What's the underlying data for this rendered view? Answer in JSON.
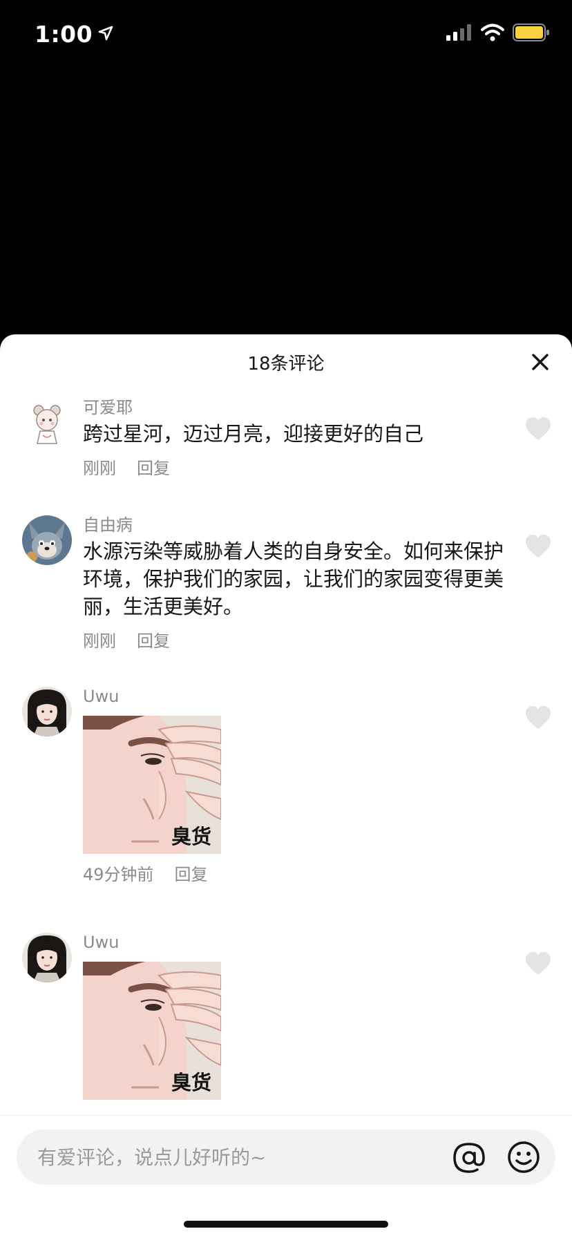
{
  "status_bar": {
    "time": "1:00"
  },
  "sheet": {
    "title": "18条评论"
  },
  "comments": [
    {
      "name": "可爱耶",
      "text": "跨过星河，迈过月亮，迎接更好的自己",
      "time": "刚刚",
      "reply": "回复"
    },
    {
      "name": "自由病",
      "text": "水源污染等威胁着人类的自身安全。如何来保护环境，保护我们的家园，让我们的家园变得更美丽，生活更美好。",
      "time": "刚刚",
      "reply": "回复"
    },
    {
      "name": "Uwu",
      "sticker_caption": "臭货",
      "time": "49分钟前",
      "reply": "回复"
    },
    {
      "name": "Uwu",
      "sticker_caption": "臭货"
    }
  ],
  "input": {
    "placeholder": "有爱评论，说点儿好听的~"
  },
  "colors": {
    "background": "#000000",
    "sheet": "#ffffff",
    "muted_text": "#8a8a8a",
    "input_bg": "#f2f2f2",
    "battery": "#f5d23c"
  }
}
